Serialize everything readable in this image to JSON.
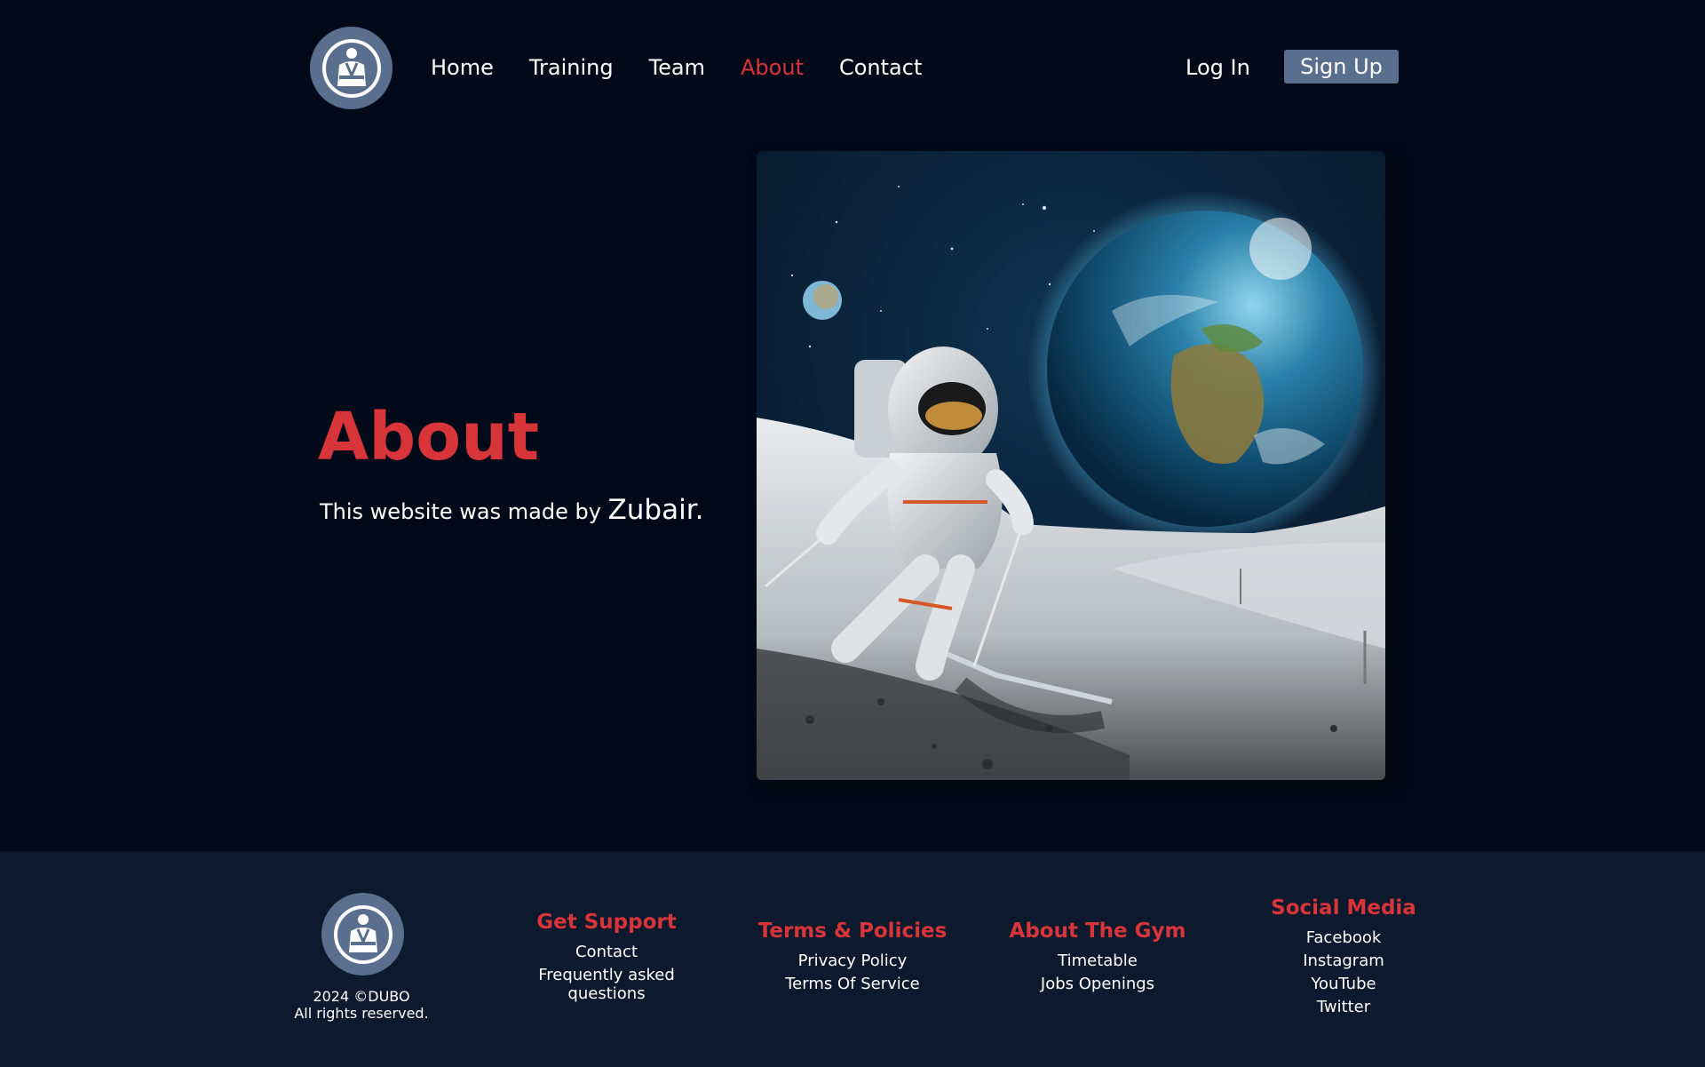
{
  "nav": {
    "logo_icon": "judo-gi-logo-icon",
    "items": [
      {
        "label": "Home",
        "active": false
      },
      {
        "label": "Training",
        "active": false
      },
      {
        "label": "Team",
        "active": false
      },
      {
        "label": "About",
        "active": true
      },
      {
        "label": "Contact",
        "active": false
      }
    ],
    "login_label": "Log In",
    "signup_label": "Sign Up"
  },
  "hero": {
    "title": "About",
    "text_prefix": "This website was made by ",
    "author": "Zubair.",
    "image_icon": "astronaut-skiing-moon-image"
  },
  "footer": {
    "logo_icon": "judo-gi-logo-icon",
    "copyright_line1": "2024 ©DUBO",
    "copyright_line2": "All rights reserved.",
    "columns": [
      {
        "title": "Get Support",
        "links": [
          "Contact",
          "Frequently asked questions"
        ]
      },
      {
        "title": "Terms & Policies",
        "links": [
          "Privacy Policy",
          "Terms Of Service"
        ]
      },
      {
        "title": "About The Gym",
        "links": [
          "Timetable",
          "Jobs Openings"
        ]
      },
      {
        "title": "Social Media",
        "links": [
          "Facebook",
          "Instagram",
          "YouTube",
          "Twitter"
        ]
      }
    ]
  },
  "colors": {
    "background": "#020a1a",
    "footer_bg": "#0d1a2d",
    "accent_red": "#d8353a",
    "logo_blue": "#5a6e8e"
  }
}
